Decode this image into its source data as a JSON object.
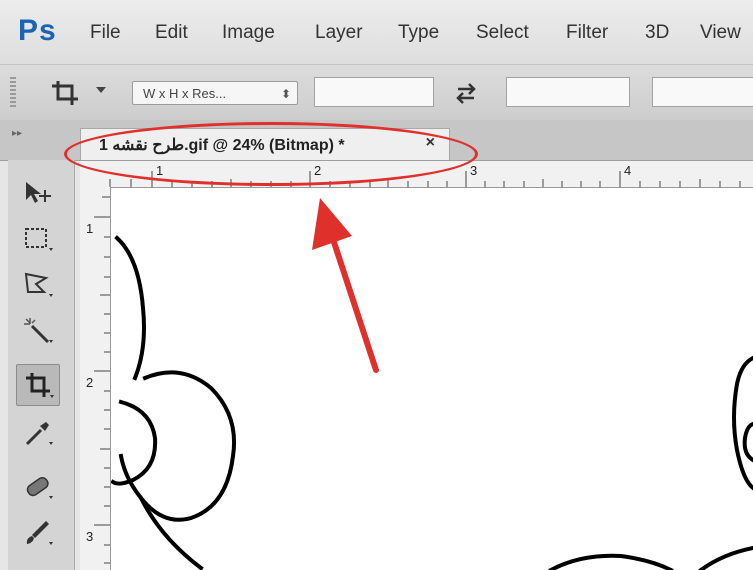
{
  "app": {
    "logo": "Ps",
    "menu": [
      "File",
      "Edit",
      "Image",
      "Layer",
      "Type",
      "Select",
      "Filter",
      "3D",
      "View"
    ]
  },
  "options_bar": {
    "tool_icon": "crop-icon",
    "preset_label": "W x H x Res...",
    "swap_icon": "swap-arrows-icon"
  },
  "document_tab": {
    "title": "1 طرح نقشه.gif @ 24% (Bitmap) *",
    "close_label": "×"
  },
  "toolbox": {
    "tools": [
      "move-icon",
      "rectangular-marquee-icon",
      "polygonal-lasso-icon",
      "magic-wand-icon",
      "crop-icon",
      "eyedropper-icon",
      "spot-healing-brush-icon",
      "brush-icon"
    ],
    "active_tool": "crop-icon"
  },
  "rulers": {
    "top": [
      "1",
      "2",
      "3",
      "4"
    ],
    "left": [
      "1",
      "2",
      "3"
    ]
  },
  "annotation": {
    "color": "#e0302c"
  },
  "colors": {
    "ps_blue": "#1b64b5"
  }
}
